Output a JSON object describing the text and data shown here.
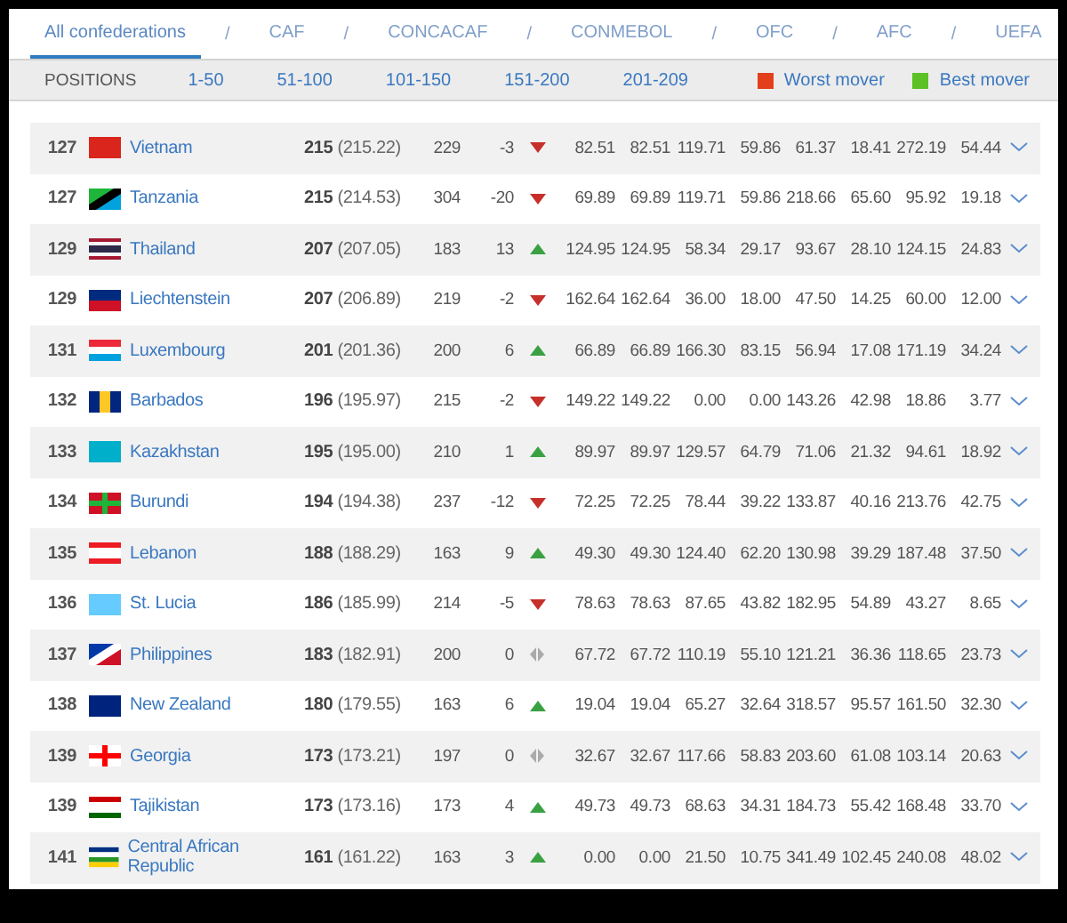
{
  "confederations": [
    {
      "label": "All confederations",
      "selected": true
    },
    {
      "label": "CAF",
      "selected": false
    },
    {
      "label": "CONCACAF",
      "selected": false
    },
    {
      "label": "CONMEBOL",
      "selected": false
    },
    {
      "label": "OFC",
      "selected": false
    },
    {
      "label": "AFC",
      "selected": false
    },
    {
      "label": "UEFA",
      "selected": false
    }
  ],
  "separator": "/",
  "positions": {
    "label": "POSITIONS",
    "ranges": [
      "1-50",
      "51-100",
      "101-150",
      "151-200",
      "201-209"
    ]
  },
  "legend": [
    {
      "label": "Worst mover",
      "color": "#e2401c"
    },
    {
      "label": "Best mover",
      "color": "#5cc124"
    }
  ],
  "rows": [
    {
      "rank": "127",
      "name": "Vietnam",
      "points": "215",
      "exact": "(215.22)",
      "previous": "229",
      "change": "-3",
      "kind": "down",
      "values": [
        "82.51",
        "82.51",
        "119.71",
        "59.86",
        "61.37",
        "18.41",
        "272.19",
        "54.44"
      ]
    },
    {
      "rank": "127",
      "name": "Tanzania",
      "points": "215",
      "exact": "(214.53)",
      "previous": "304",
      "change": "-20",
      "kind": "down",
      "values": [
        "69.89",
        "69.89",
        "119.71",
        "59.86",
        "218.66",
        "65.60",
        "95.92",
        "19.18"
      ]
    },
    {
      "rank": "129",
      "name": "Thailand",
      "points": "207",
      "exact": "(207.05)",
      "previous": "183",
      "change": "13",
      "kind": "up",
      "values": [
        "124.95",
        "124.95",
        "58.34",
        "29.17",
        "93.67",
        "28.10",
        "124.15",
        "24.83"
      ]
    },
    {
      "rank": "129",
      "name": "Liechtenstein",
      "points": "207",
      "exact": "(206.89)",
      "previous": "219",
      "change": "-2",
      "kind": "down",
      "values": [
        "162.64",
        "162.64",
        "36.00",
        "18.00",
        "47.50",
        "14.25",
        "60.00",
        "12.00"
      ]
    },
    {
      "rank": "131",
      "name": "Luxembourg",
      "points": "201",
      "exact": "(201.36)",
      "previous": "200",
      "change": "6",
      "kind": "up",
      "values": [
        "66.89",
        "66.89",
        "166.30",
        "83.15",
        "56.94",
        "17.08",
        "171.19",
        "34.24"
      ]
    },
    {
      "rank": "132",
      "name": "Barbados",
      "points": "196",
      "exact": "(195.97)",
      "previous": "215",
      "change": "-2",
      "kind": "down",
      "values": [
        "149.22",
        "149.22",
        "0.00",
        "0.00",
        "143.26",
        "42.98",
        "18.86",
        "3.77"
      ]
    },
    {
      "rank": "133",
      "name": "Kazakhstan",
      "points": "195",
      "exact": "(195.00)",
      "previous": "210",
      "change": "1",
      "kind": "up",
      "values": [
        "89.97",
        "89.97",
        "129.57",
        "64.79",
        "71.06",
        "21.32",
        "94.61",
        "18.92"
      ]
    },
    {
      "rank": "134",
      "name": "Burundi",
      "points": "194",
      "exact": "(194.38)",
      "previous": "237",
      "change": "-12",
      "kind": "down",
      "values": [
        "72.25",
        "72.25",
        "78.44",
        "39.22",
        "133.87",
        "40.16",
        "213.76",
        "42.75"
      ]
    },
    {
      "rank": "135",
      "name": "Lebanon",
      "points": "188",
      "exact": "(188.29)",
      "previous": "163",
      "change": "9",
      "kind": "up",
      "values": [
        "49.30",
        "49.30",
        "124.40",
        "62.20",
        "130.98",
        "39.29",
        "187.48",
        "37.50"
      ]
    },
    {
      "rank": "136",
      "name": "St. Lucia",
      "points": "186",
      "exact": "(185.99)",
      "previous": "214",
      "change": "-5",
      "kind": "down",
      "values": [
        "78.63",
        "78.63",
        "87.65",
        "43.82",
        "182.95",
        "54.89",
        "43.27",
        "8.65"
      ]
    },
    {
      "rank": "137",
      "name": "Philippines",
      "points": "183",
      "exact": "(182.91)",
      "previous": "200",
      "change": "0",
      "kind": "same",
      "values": [
        "67.72",
        "67.72",
        "110.19",
        "55.10",
        "121.21",
        "36.36",
        "118.65",
        "23.73"
      ]
    },
    {
      "rank": "138",
      "name": "New Zealand",
      "points": "180",
      "exact": "(179.55)",
      "previous": "163",
      "change": "6",
      "kind": "up",
      "values": [
        "19.04",
        "19.04",
        "65.27",
        "32.64",
        "318.57",
        "95.57",
        "161.50",
        "32.30"
      ]
    },
    {
      "rank": "139",
      "name": "Georgia",
      "points": "173",
      "exact": "(173.21)",
      "previous": "197",
      "change": "0",
      "kind": "same",
      "values": [
        "32.67",
        "32.67",
        "117.66",
        "58.83",
        "203.60",
        "61.08",
        "103.14",
        "20.63"
      ]
    },
    {
      "rank": "139",
      "name": "Tajikistan",
      "points": "173",
      "exact": "(173.16)",
      "previous": "173",
      "change": "4",
      "kind": "up",
      "values": [
        "49.73",
        "49.73",
        "68.63",
        "34.31",
        "184.73",
        "55.42",
        "168.48",
        "33.70"
      ]
    },
    {
      "rank": "141",
      "name": "Central African Republic",
      "points": "161",
      "exact": "(161.22)",
      "previous": "163",
      "change": "3",
      "kind": "up",
      "values": [
        "0.00",
        "0.00",
        "21.50",
        "10.75",
        "341.49",
        "102.45",
        "240.08",
        "48.02"
      ]
    }
  ]
}
